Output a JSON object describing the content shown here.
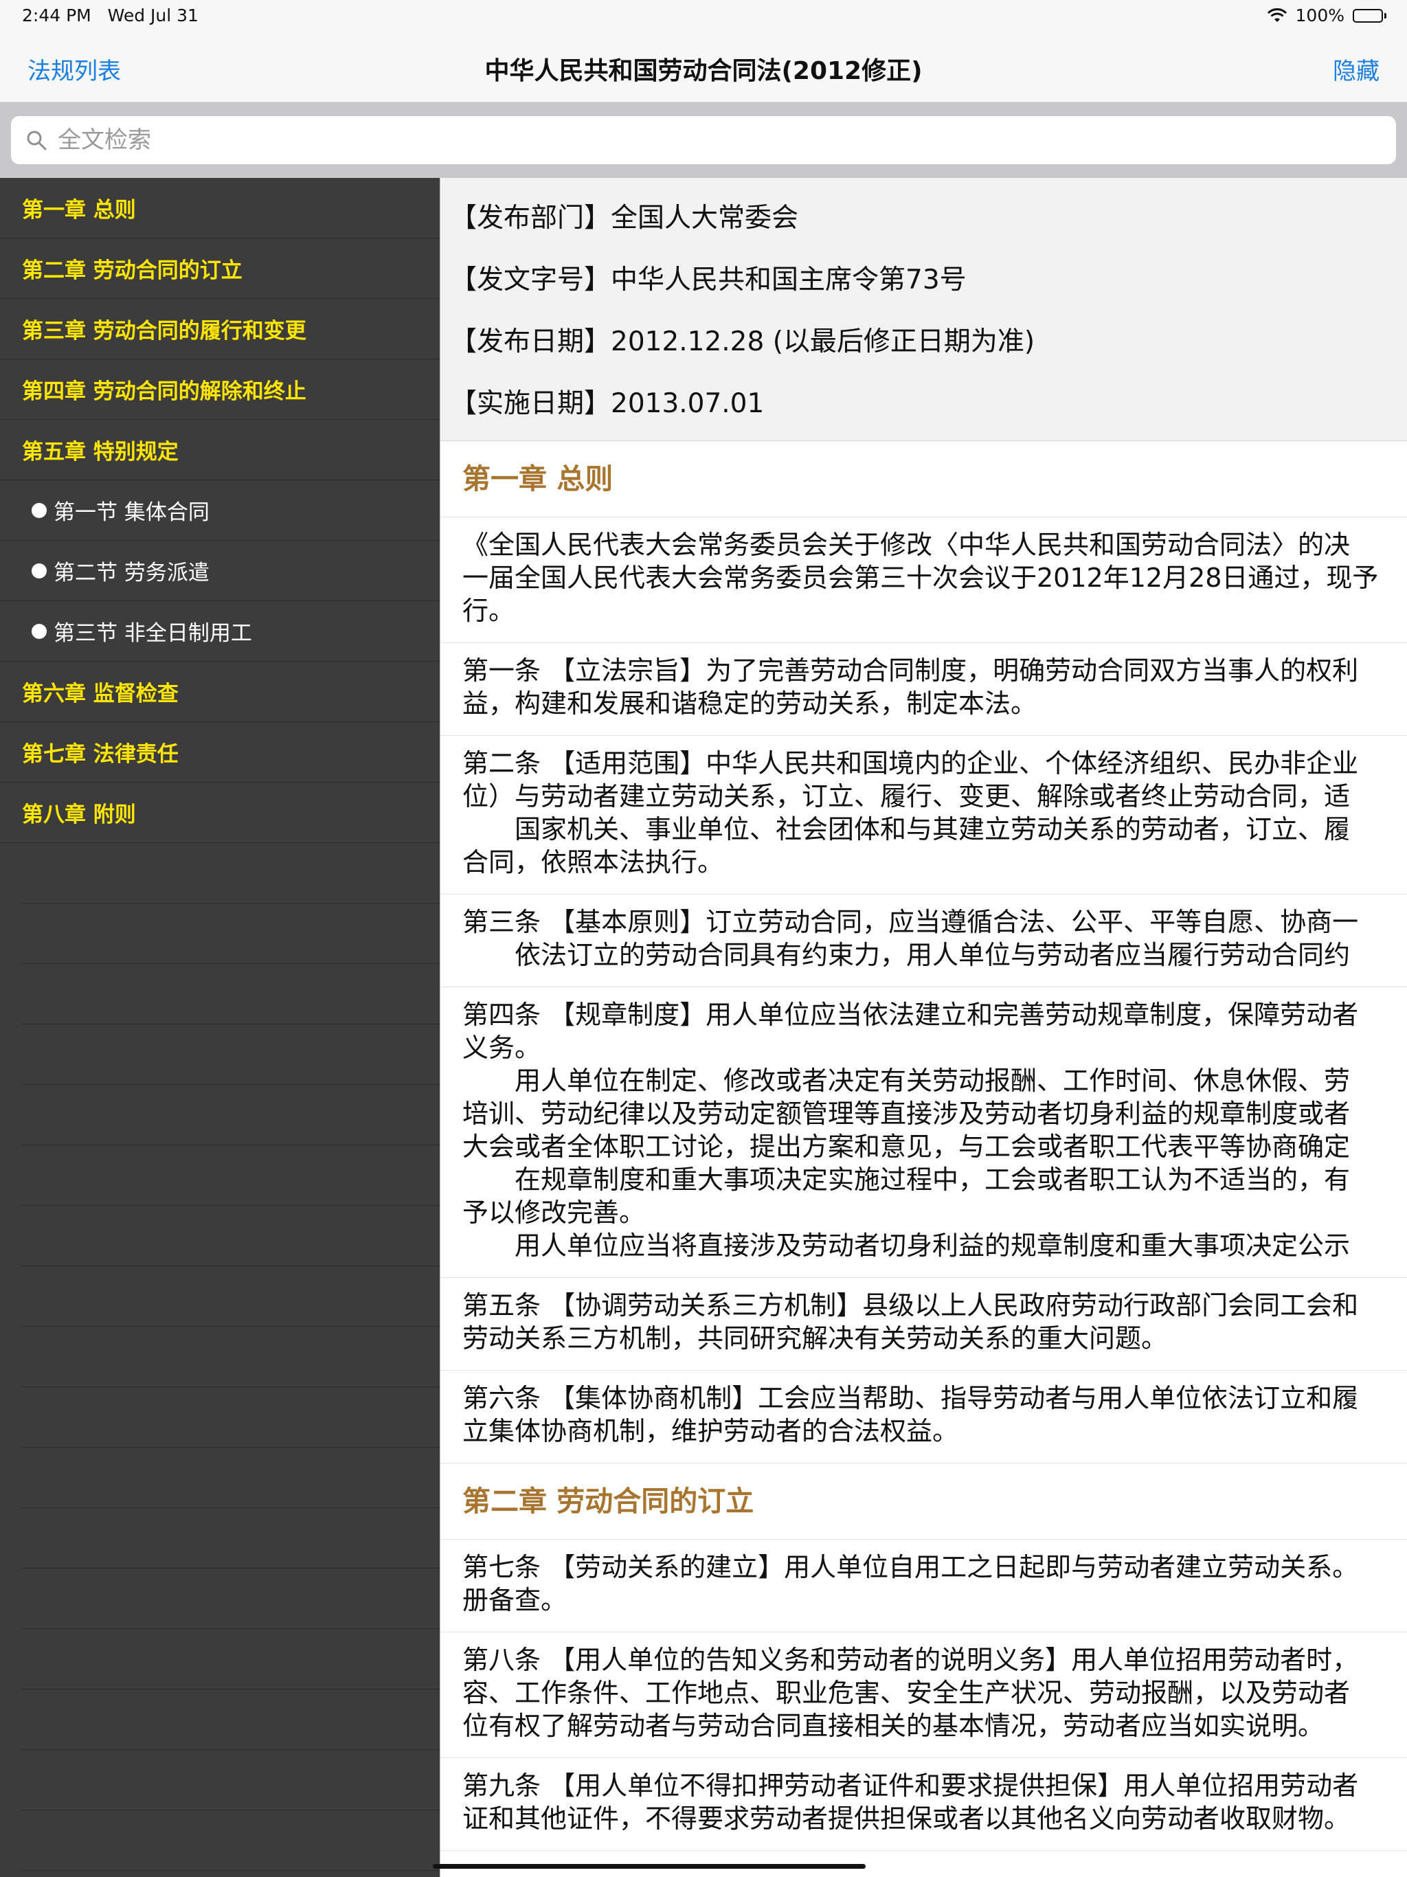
{
  "status_bar": {
    "time": "2:44 PM",
    "date": "Wed Jul 31",
    "battery": "100%",
    "battery_level": 1.0
  },
  "nav": {
    "left_label": "法规列表",
    "title": "中华人民共和国劳动合同法(2012修正)",
    "right_label": "隐藏"
  },
  "search": {
    "placeholder": "全文检索"
  },
  "sidebar": {
    "items": [
      {
        "label": "第一章 总则",
        "type": "chapter"
      },
      {
        "label": "第二章 劳动合同的订立",
        "type": "chapter"
      },
      {
        "label": "第三章 劳动合同的履行和变更",
        "type": "chapter"
      },
      {
        "label": "第四章 劳动合同的解除和终止",
        "type": "chapter"
      },
      {
        "label": "第五章 特别规定",
        "type": "chapter"
      },
      {
        "label": "第一节 集体合同",
        "type": "section"
      },
      {
        "label": "第二节 劳务派遣",
        "type": "section"
      },
      {
        "label": "第三节 非全日制用工",
        "type": "section"
      },
      {
        "label": "第六章 监督检查",
        "type": "chapter"
      },
      {
        "label": "第七章 法律责任",
        "type": "chapter"
      },
      {
        "label": "第八章 附则",
        "type": "chapter"
      }
    ]
  },
  "meta": {
    "publisher": "【发布部门】全国人大常委会",
    "doc_number": "【发文字号】中华人民共和国主席令第73号",
    "publish_date": "【发布日期】2012.12.28 (以最后修正日期为准)",
    "effective_date": "【实施日期】2013.07.01"
  },
  "content": {
    "chapter1_heading": "第一章 总则",
    "preamble": "《全国人民代表大会常务委员会关于修改〈中华人民共和国劳动合同法〉的决\n一届全国人民代表大会常务委员会第三十次会议于2012年12月28日通过，现予\n行。",
    "article1": "第一条 【立法宗旨】为了完善劳动合同制度，明确劳动合同双方当事人的权利\n益，构建和发展和谐稳定的劳动关系，制定本法。",
    "article2": "第二条 【适用范围】中华人民共和国境内的企业、个体经济组织、民办非企业\n位）与劳动者建立劳动关系，订立、履行、变更、解除或者终止劳动合同，适\n　　国家机关、事业单位、社会团体和与其建立劳动关系的劳动者，订立、履\n合同，依照本法执行。",
    "article3": "第三条 【基本原则】订立劳动合同，应当遵循合法、公平、平等自愿、协商一\n　　依法订立的劳动合同具有约束力，用人单位与劳动者应当履行劳动合同约",
    "article4": "第四条 【规章制度】用人单位应当依法建立和完善劳动规章制度，保障劳动者\n义务。\n　　用人单位在制定、修改或者决定有关劳动报酬、工作时间、休息休假、劳\n培训、劳动纪律以及劳动定额管理等直接涉及劳动者切身利益的规章制度或者\n大会或者全体职工讨论，提出方案和意见，与工会或者职工代表平等协商确定\n　　在规章制度和重大事项决定实施过程中，工会或者职工认为不适当的，有\n予以修改完善。\n　　用人单位应当将直接涉及劳动者切身利益的规章制度和重大事项决定公示",
    "article5": "第五条 【协调劳动关系三方机制】县级以上人民政府劳动行政部门会同工会和\n劳动关系三方机制，共同研究解决有关劳动关系的重大问题。",
    "article6": "第六条 【集体协商机制】工会应当帮助、指导劳动者与用人单位依法订立和履\n立集体协商机制，维护劳动者的合法权益。",
    "chapter2_heading": "第二章 劳动合同的订立",
    "article7": "第七条 【劳动关系的建立】用人单位自用工之日起即与劳动者建立劳动关系。\n册备查。",
    "article8": "第八条 【用人单位的告知义务和劳动者的说明义务】用人单位招用劳动者时，\n容、工作条件、工作地点、职业危害、安全生产状况、劳动报酬，以及劳动者\n位有权了解劳动者与劳动合同直接相关的基本情况，劳动者应当如实说明。",
    "article9": "第九条 【用人单位不得扣押劳动者证件和要求提供担保】用人单位招用劳动者\n证和其他证件，不得要求劳动者提供担保或者以其他名义向劳动者收取财物。"
  }
}
